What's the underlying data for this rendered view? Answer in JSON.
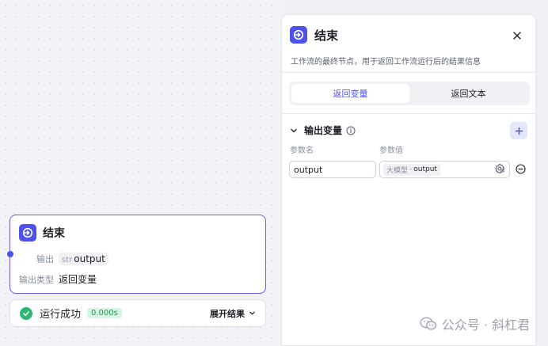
{
  "node": {
    "title": "结束",
    "rows": [
      {
        "label": "输出",
        "type": "str",
        "value": "output"
      },
      {
        "label": "输出类型",
        "value": "返回变量"
      }
    ]
  },
  "run": {
    "status": "运行成功",
    "time": "0.000s",
    "expand": "展开结果"
  },
  "panel": {
    "title": "结束",
    "description": "工作流的最终节点，用于返回工作流运行后的结果信息",
    "tabs": [
      "返回变量",
      "返回文本"
    ],
    "active_tab": "返回变量",
    "section_title": "输出变量",
    "columns": {
      "name": "参数名",
      "value": "参数值"
    },
    "params": [
      {
        "name": "output",
        "source": "大模型",
        "variable": "output"
      }
    ]
  },
  "watermark": "公众号 · 斜杠君",
  "colors": {
    "accent": "#4d53e8",
    "success": "#2bb673",
    "node_border": "#6a5cf0"
  },
  "icons": {
    "node": "exit-node-icon",
    "close": "close-icon",
    "info": "info-icon",
    "add": "plus-icon",
    "gear": "gear-icon",
    "remove": "minus-circle-icon",
    "ok": "check-circle-icon",
    "chevron": "chevron-down-icon"
  }
}
